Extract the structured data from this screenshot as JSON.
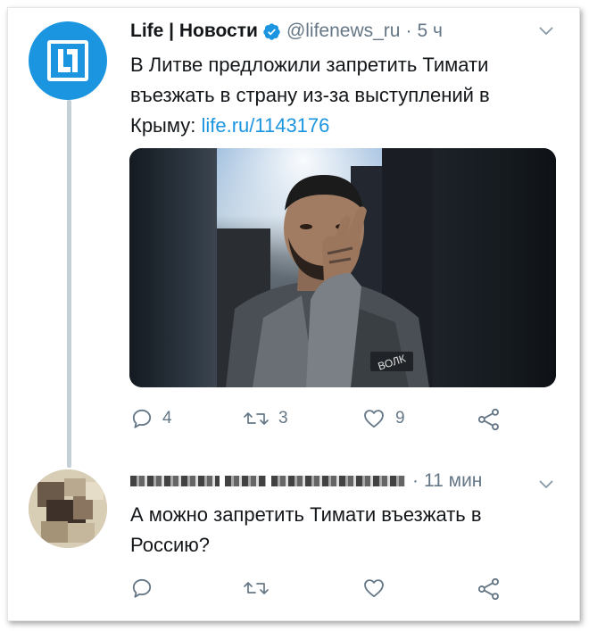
{
  "tweet": {
    "author_name": "Life | Новости",
    "handle": "@lifenews_ru",
    "separator": "·",
    "time": "5 ч",
    "text_main": "В Литве предложили запретить Тимати въезжать в страну из-за выступлений в Крыму: ",
    "link": "life.ru/1143176",
    "media_badge": "ВОЛК",
    "actions": {
      "replies": "4",
      "retweets": "3",
      "likes": "9"
    }
  },
  "reply": {
    "separator": "·",
    "time": "11 мин",
    "text": "А можно запретить Тимати въезжать в Россию?"
  },
  "colors": {
    "accent": "#1b95e0",
    "muted": "#657786",
    "thread_line": "#c4cfd6"
  },
  "icons": {
    "verified": "verified-badge-icon",
    "caret": "chevron-down-icon",
    "reply": "reply-icon",
    "retweet": "retweet-icon",
    "like": "heart-icon",
    "share": "share-icon"
  }
}
